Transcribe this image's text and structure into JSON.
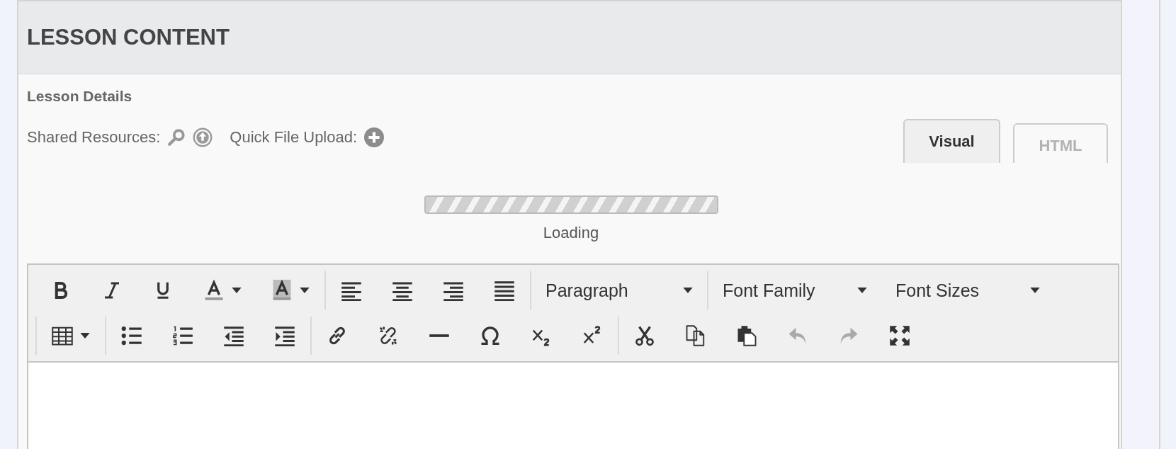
{
  "section": {
    "title": "LESSON CONTENT"
  },
  "subheading": "Lesson Details",
  "resources": {
    "shared_label": "Shared Resources:",
    "upload_label": "Quick File Upload:"
  },
  "editor_tabs": [
    {
      "label": "Visual",
      "selected": true
    },
    {
      "label": "HTML",
      "selected": false
    }
  ],
  "loading": {
    "label": "Loading",
    "level": 1
  },
  "toolbar": {
    "rows": [
      [
        [
          {
            "kind": "bold",
            "disabled": false
          },
          {
            "kind": "italic",
            "disabled": false
          },
          {
            "kind": "underline",
            "disabled": false
          },
          {
            "kind": "text-color",
            "disabled": false
          },
          {
            "kind": "background-color",
            "disabled": false
          }
        ],
        [
          {
            "kind": "align-left",
            "disabled": false
          },
          {
            "kind": "align-center",
            "disabled": false
          },
          {
            "kind": "align-right",
            "disabled": false
          },
          {
            "kind": "justify",
            "disabled": false
          }
        ],
        [
          {
            "kind": "select",
            "label": "Paragraph"
          }
        ],
        [
          {
            "kind": "select",
            "label": "Font Family"
          },
          {
            "kind": "select",
            "label": "Font Sizes"
          }
        ]
      ],
      [
        [
          {
            "kind": "table",
            "disabled": false
          }
        ],
        [
          {
            "kind": "bullet-list",
            "disabled": false
          },
          {
            "kind": "numbered-list",
            "disabled": false
          },
          {
            "kind": "outdent",
            "disabled": false
          },
          {
            "kind": "indent",
            "disabled": false
          }
        ],
        [
          {
            "kind": "link",
            "disabled": false
          },
          {
            "kind": "unlink",
            "disabled": false
          },
          {
            "kind": "horizontal-rule",
            "disabled": false
          },
          {
            "kind": "special-character",
            "disabled": false
          },
          {
            "kind": "subscript",
            "disabled": false
          },
          {
            "kind": "superscript",
            "disabled": false
          }
        ],
        [
          {
            "kind": "cut",
            "disabled": false
          },
          {
            "kind": "copy",
            "disabled": false
          },
          {
            "kind": "paste",
            "disabled": false
          },
          {
            "kind": "undo",
            "disabled": true
          },
          {
            "kind": "redo",
            "disabled": true
          },
          {
            "kind": "fullscreen",
            "disabled": false
          }
        ]
      ]
    ]
  }
}
